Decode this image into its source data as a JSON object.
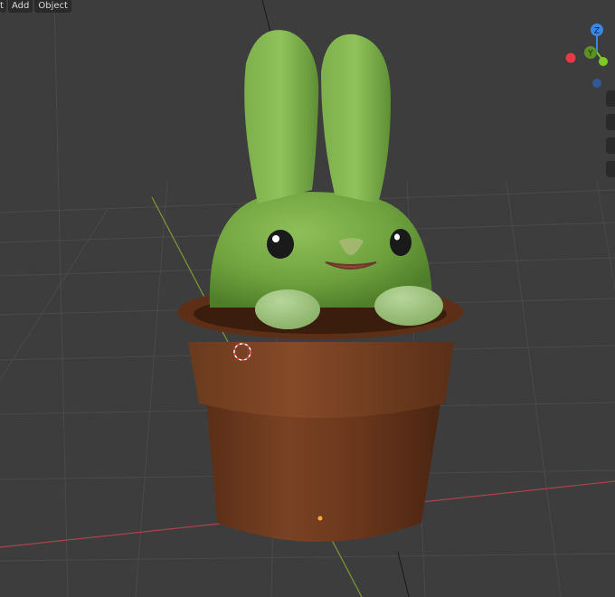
{
  "menubar": {
    "items": [
      {
        "label": "t"
      },
      {
        "label": "Add"
      },
      {
        "label": "Object"
      }
    ]
  },
  "gizmo": {
    "z_label": "Z",
    "y_label": "Y",
    "colors": {
      "x": "#e8394b",
      "y": "#7fc82a",
      "z": "#3b86e3",
      "neg_z": "#305894"
    }
  },
  "viewport": {
    "background": "#3d3d3d",
    "grid_color": "#4a4a4a",
    "x_axis_color": "#a8434a",
    "y_axis_color": "#7b9a36"
  },
  "right_tools": {
    "stubs": [
      "",
      "",
      "",
      ""
    ]
  }
}
